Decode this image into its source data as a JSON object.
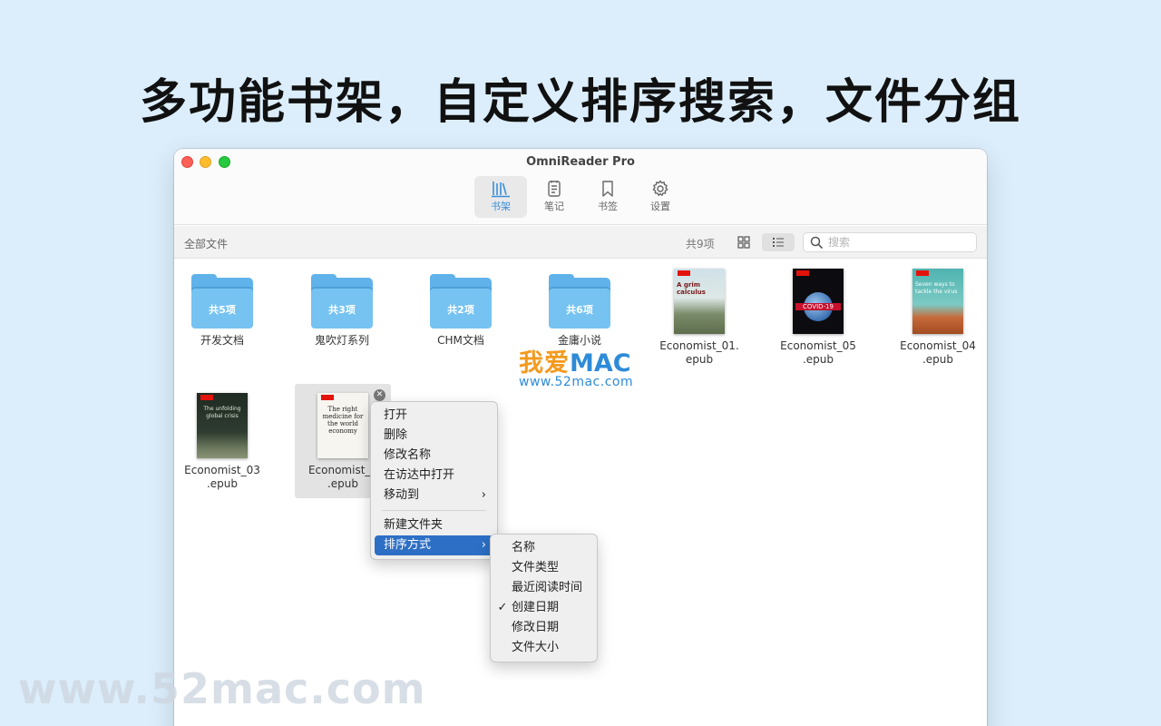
{
  "headline": "多功能书架，自定义排序搜索，文件分组",
  "window": {
    "title": "OmniReader Pro"
  },
  "toolbar": {
    "tabs": [
      {
        "label": "书架",
        "icon": "bookshelf-icon",
        "active": true
      },
      {
        "label": "笔记",
        "icon": "notes-icon"
      },
      {
        "label": "书签",
        "icon": "bookmark-icon"
      },
      {
        "label": "设置",
        "icon": "gear-icon"
      }
    ]
  },
  "subbar": {
    "breadcrumb": "全部文件",
    "count": "共9项",
    "search_placeholder": "搜索"
  },
  "items": [
    {
      "type": "folder",
      "name": "开发文档",
      "count": "共5项"
    },
    {
      "type": "folder",
      "name": "鬼吹灯系列",
      "count": "共3项"
    },
    {
      "type": "folder",
      "name": "CHM文档",
      "count": "共2项"
    },
    {
      "type": "folder",
      "name": "金庸小说",
      "count": "共6项"
    },
    {
      "type": "book",
      "name_line1": "Economist_01.",
      "name_line2": "epub",
      "cover_text": "A grim calculus"
    },
    {
      "type": "book",
      "name_line1": "Economist_05",
      "name_line2": ".epub",
      "cover_text": "COVID-19"
    },
    {
      "type": "book",
      "name_line1": "Economist_04",
      "name_line2": ".epub",
      "cover_text": "Seven ways to tackle the virus"
    },
    {
      "type": "book",
      "name_line1": "Economist_03",
      "name_line2": ".epub",
      "cover_text": "The unfolding global crisis"
    },
    {
      "type": "book",
      "name_line1": "Economist_0",
      "name_line2": ".epub",
      "cover_text": "The right medicine for the world economy",
      "selected": true
    }
  ],
  "watermark": {
    "cn": "我爱",
    "mac": "MAC",
    "url": "www.52mac.com"
  },
  "context_menu": {
    "items": [
      "打开",
      "删除",
      "修改名称",
      "在访达中打开",
      "移动到"
    ],
    "items2": [
      "新建文件夹",
      "排序方式"
    ]
  },
  "sort_menu": {
    "items": [
      "名称",
      "文件类型",
      "最近阅读时间",
      "创建日期",
      "修改日期",
      "文件大小"
    ],
    "checked": "创建日期"
  },
  "bottom_watermark": "www.52mac.com",
  "colors": {
    "accent": "#3a8fd8",
    "folder": "#76c3f2",
    "menu_highlight": "#2d6fc4"
  }
}
